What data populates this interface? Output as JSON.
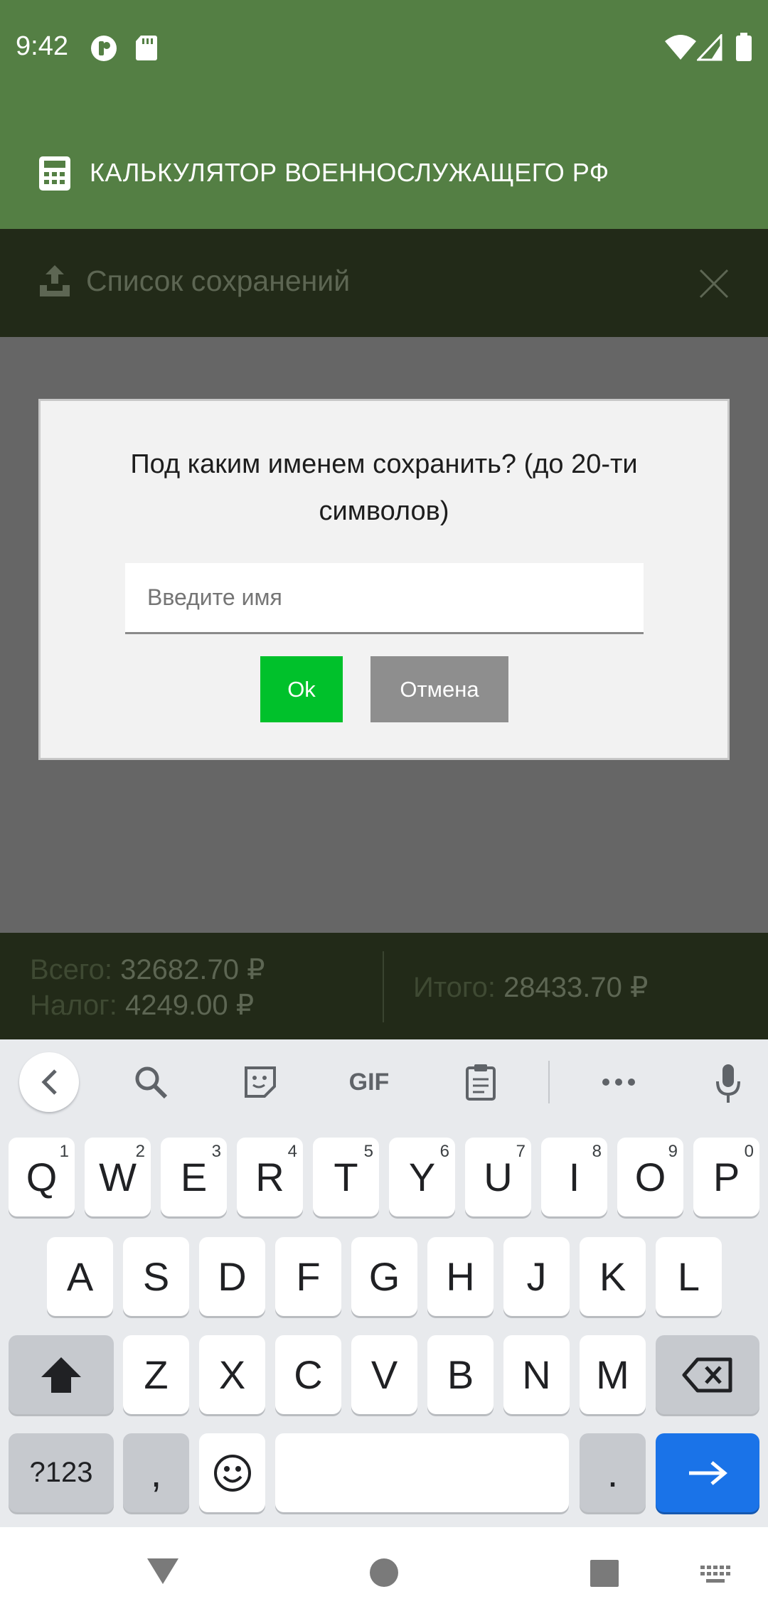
{
  "status_bar": {
    "time": "9:42"
  },
  "app_bar": {
    "title": "КАЛЬКУЛЯТОР ВОЕННОСЛУЖАЩЕГО РФ"
  },
  "saves_panel": {
    "title": "Список сохранений"
  },
  "dialog": {
    "message": "Под каким именем сохранить? (до 20-ти символов)",
    "input_placeholder": "Введите имя",
    "input_value": "",
    "ok_label": "Ok",
    "cancel_label": "Отмена"
  },
  "totals": {
    "total_label": "Всего:",
    "total_value": "32682.70 ₽",
    "tax_label": "Налог:",
    "tax_value": "4249.00 ₽",
    "result_label": "Итого:",
    "result_value": "28433.70 ₽"
  },
  "keyboard": {
    "toolbar": {
      "gif_label": "GIF"
    },
    "row1": [
      {
        "k": "Q",
        "h": "1"
      },
      {
        "k": "W",
        "h": "2"
      },
      {
        "k": "E",
        "h": "3"
      },
      {
        "k": "R",
        "h": "4"
      },
      {
        "k": "T",
        "h": "5"
      },
      {
        "k": "Y",
        "h": "6"
      },
      {
        "k": "U",
        "h": "7"
      },
      {
        "k": "I",
        "h": "8"
      },
      {
        "k": "O",
        "h": "9"
      },
      {
        "k": "P",
        "h": "0"
      }
    ],
    "row2": [
      "A",
      "S",
      "D",
      "F",
      "G",
      "H",
      "J",
      "K",
      "L"
    ],
    "row3": [
      "Z",
      "X",
      "C",
      "V",
      "B",
      "N",
      "M"
    ],
    "symbols_label": "?123",
    "comma_label": ",",
    "period_label": "."
  },
  "colors": {
    "app_bar": "#547f44",
    "ok_button": "#00c12b",
    "cancel_button": "#8e8e8e",
    "enter_key": "#1a73e8"
  }
}
